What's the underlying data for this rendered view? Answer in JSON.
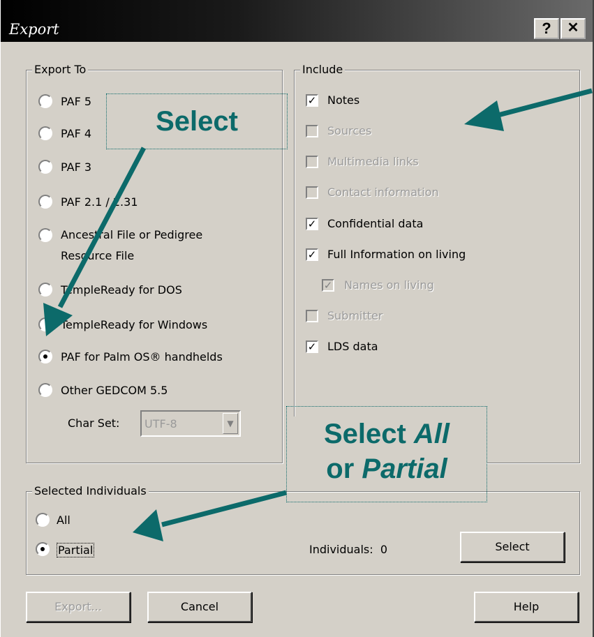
{
  "window": {
    "title": "Export",
    "help_btn": "?",
    "close_btn": "✕"
  },
  "export_to": {
    "label": "Export To",
    "options": [
      {
        "label": "PAF 5",
        "selected": false
      },
      {
        "label": "PAF 4",
        "selected": false
      },
      {
        "label": "PAF 3",
        "selected": false
      },
      {
        "label": "PAF 2.1 / 2.31",
        "selected": false
      },
      {
        "label": "Ancestral File or Pedigree",
        "label2": "Resource File",
        "selected": false
      },
      {
        "label": "TempleReady for DOS",
        "selected": false
      },
      {
        "label": "TempleReady for Windows",
        "selected": false
      },
      {
        "label": "PAF for Palm OS® handhelds",
        "selected": true
      },
      {
        "label": "Other GEDCOM 5.5",
        "selected": false
      }
    ],
    "charset_label": "Char Set:",
    "charset_value": "UTF-8"
  },
  "include": {
    "label": "Include",
    "items": [
      {
        "label": "Notes",
        "checked": true,
        "enabled": true
      },
      {
        "label": "Sources",
        "checked": false,
        "enabled": false
      },
      {
        "label": "Multimedia links",
        "checked": false,
        "enabled": false
      },
      {
        "label": "Contact information",
        "checked": false,
        "enabled": false
      },
      {
        "label": "Confidential data",
        "checked": true,
        "enabled": true
      },
      {
        "label": "Full Information on living",
        "checked": true,
        "enabled": true
      },
      {
        "label": "Names on living",
        "checked": true,
        "enabled": false
      },
      {
        "label": "Submitter",
        "checked": false,
        "enabled": false
      },
      {
        "label": "LDS data",
        "checked": true,
        "enabled": true
      }
    ]
  },
  "selected_individuals": {
    "label": "Selected Individuals",
    "all_label": "All",
    "partial_label": "Partial",
    "count_text": "Individuals:  0",
    "select_button": "Select"
  },
  "buttons": {
    "export": "Export...",
    "cancel": "Cancel",
    "help": "Help"
  },
  "callouts": {
    "select": "Select",
    "select_all_a": "Select ",
    "select_all_b": "All",
    "select_all_c": "or ",
    "select_all_d": "Partial"
  },
  "colors": {
    "callout": "#0c6a6a",
    "background": "#ffffcc",
    "dialog": "#d4d0c8"
  }
}
